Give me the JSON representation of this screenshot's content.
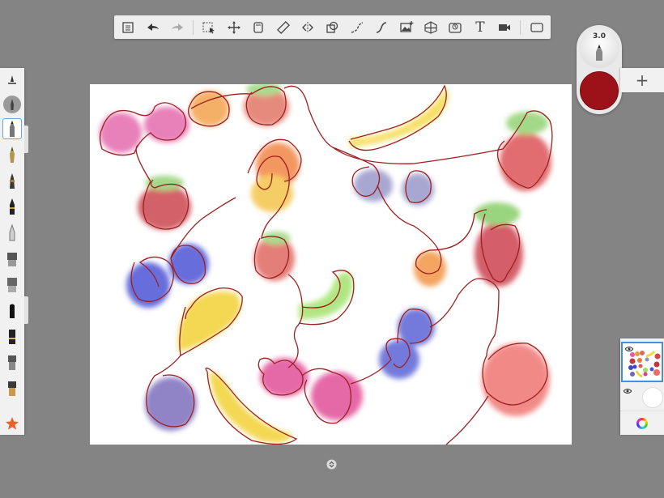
{
  "toolbar": {
    "tools": [
      "menu-icon",
      "undo-icon",
      "redo-icon",
      "selection-icon",
      "transform-icon",
      "layer-icon",
      "ruler-icon",
      "symmetry-icon",
      "shapes-icon",
      "stroke-icon",
      "curve-icon",
      "image-icon",
      "perspective-icon",
      "time-icon",
      "text-tool-icon",
      "video-icon",
      "fullscreen-icon"
    ],
    "text_tool_label": "T"
  },
  "puck": {
    "brush_size": "3.0",
    "color": "#9d1219"
  },
  "layers": {
    "add_label": "+"
  },
  "brushes": [
    "brush-settings-icon",
    "soft-brush-icon",
    "pencil-icon",
    "ink-pen-icon",
    "marker-icon",
    "felt-tip-icon",
    "airbrush-icon",
    "paint-brush-icon",
    "chisel-brush-icon",
    "wide-marker-icon",
    "flat-brush-icon",
    "smudge-icon",
    "eraser-brush-icon",
    "favorites-star-icon"
  ],
  "colors": {
    "background": "#848484",
    "panel": "#f1f1f1",
    "accent": "#4a8fd6",
    "current_color": "#9d1219"
  }
}
